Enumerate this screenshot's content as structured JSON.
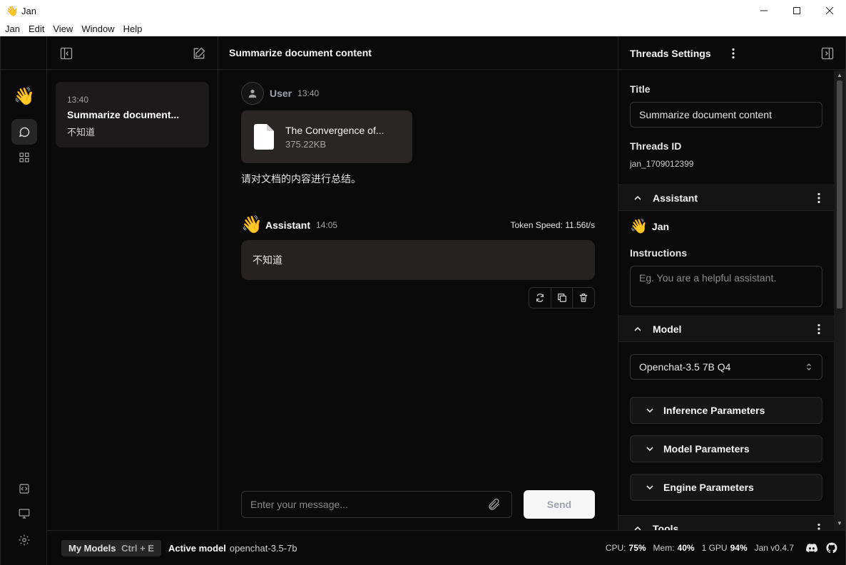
{
  "window": {
    "title": "Jan",
    "app_icon": "👋",
    "menu": [
      "Jan",
      "Edit",
      "View",
      "Window",
      "Help"
    ]
  },
  "ribbon": {
    "logo": "👋"
  },
  "threads": {
    "items": [
      {
        "time": "13:40",
        "title": "Summarize document...",
        "snippet": "不知道"
      }
    ]
  },
  "chat": {
    "title": "Summarize document content",
    "user": {
      "name": "User",
      "time": "13:40",
      "file": {
        "name": "The Convergence of...",
        "size": "375.22KB"
      },
      "text": "请对文档的内容进行总结。"
    },
    "assistant": {
      "avatar": "👋",
      "name": "Assistant",
      "time": "14:05",
      "token_speed": "Token Speed: 11.56t/s",
      "text": "不知道"
    },
    "composer": {
      "placeholder": "Enter your message...",
      "send_label": "Send"
    }
  },
  "settings": {
    "header": "Threads Settings",
    "title_label": "Title",
    "title_value": "Summarize document content",
    "thread_id_label": "Threads ID",
    "thread_id": "jan_1709012399",
    "assistant_section": "Assistant",
    "assistant_avatar": "👋",
    "assistant_name": "Jan",
    "instructions_label": "Instructions",
    "instructions_placeholder": "Eg. You are a helpful assistant.",
    "model_section": "Model",
    "model_selected": "Openchat-3.5 7B Q4",
    "params": [
      "Inference Parameters",
      "Model Parameters",
      "Engine Parameters"
    ],
    "tools_section": "Tools"
  },
  "statusbar": {
    "my_models": "My Models",
    "shortcut": "Ctrl + E",
    "active_model_label": "Active model",
    "active_model": "openchat-3.5-7b",
    "cpu_label": "CPU:",
    "cpu": "75%",
    "mem_label": "Mem:",
    "mem": "40%",
    "gpu_label": "1 GPU",
    "gpu": "94%",
    "version": "Jan v0.4.7"
  },
  "colors": {
    "background": "#0a0a0a",
    "panel": "#1c1a1a",
    "bubble": "#262222",
    "send_button": "#f5f5f5"
  }
}
